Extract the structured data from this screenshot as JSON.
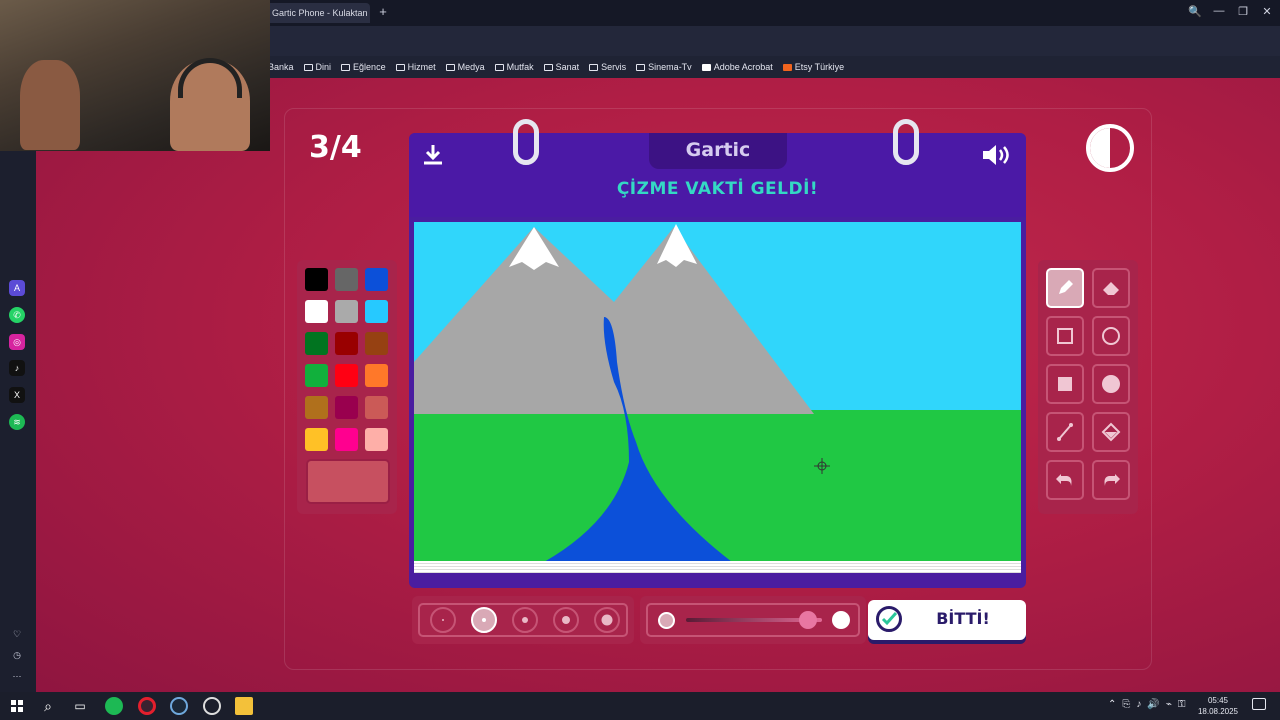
{
  "browser": {
    "tab_title": "Gartic Phone - Kulaktan Kulağa",
    "new_tab": "+",
    "window_controls": [
      "🔍",
      "—",
      "❐",
      "✕"
    ]
  },
  "bookmarks": [
    "Banka",
    "Dini",
    "Eğlence",
    "Hizmet",
    "Medya",
    "Mutfak",
    "Sanat",
    "Servis",
    "Sinema-Tv",
    "Adobe Acrobat",
    "Etsy Türkiye"
  ],
  "game": {
    "round": "3/4",
    "logo": "Gartic",
    "headline": "ÇİZME VAKTİ GELDİ!",
    "done_label": "BİTTİ!",
    "timer_remaining": 0.5,
    "opacity_level": 0.9,
    "selected_brush_size_index": 1,
    "selected_tool": "pencil",
    "current_color": "#c75060",
    "palette": [
      [
        "#000000",
        "#666666",
        "#0c50d9"
      ],
      [
        "#ffffff",
        "#aaaaaa",
        "#26c9ff"
      ],
      [
        "#017420",
        "#990000",
        "#964112"
      ],
      [
        "#11b03c",
        "#ff0013",
        "#ff7829"
      ],
      [
        "#b0701c",
        "#99004e",
        "#cb5a57"
      ],
      [
        "#ffc126",
        "#ff008f",
        "#feafa8"
      ]
    ],
    "tools": [
      "pencil-icon",
      "eraser-icon",
      "rectangle-outline-icon",
      "circle-outline-icon",
      "rectangle-filled-icon",
      "circle-filled-icon",
      "line-icon",
      "fill-bucket-icon",
      "undo-icon",
      "redo-icon"
    ]
  },
  "taskbar": {
    "time": "05:45",
    "date": "18.08.2025"
  }
}
